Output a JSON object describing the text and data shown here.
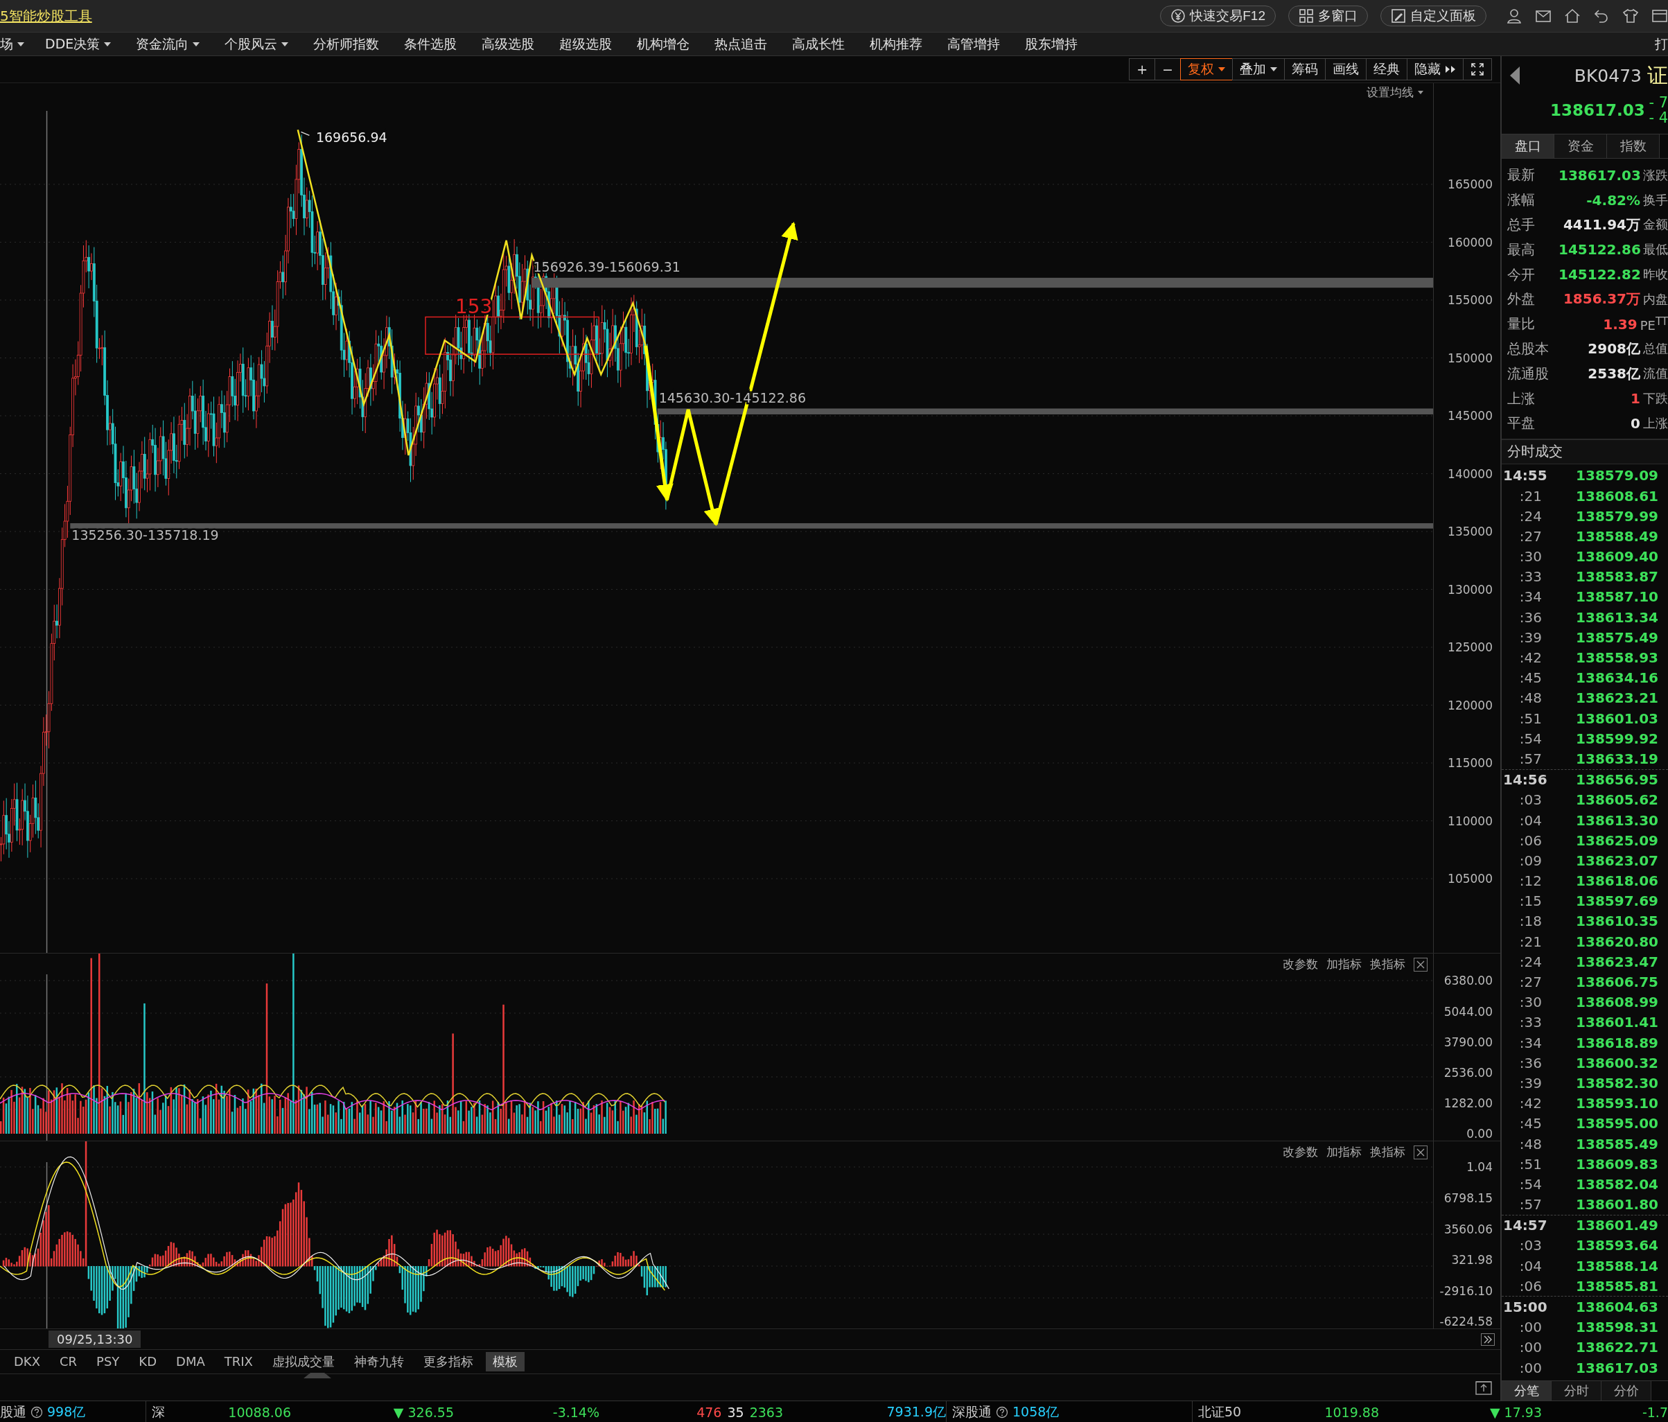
{
  "title_bar": {
    "app_title": "5智能炒股工具",
    "buttons": [
      {
        "label": "快速交易F12",
        "kind": "trade"
      },
      {
        "label": "多窗口",
        "kind": "grid"
      },
      {
        "label": "自定义面板",
        "kind": "edit"
      }
    ]
  },
  "menu": [
    {
      "label": "场",
      "dropdown": true
    },
    {
      "label": "DDE决策",
      "dropdown": true
    },
    {
      "label": "资金流向",
      "dropdown": true
    },
    {
      "label": "个股风云",
      "dropdown": true
    },
    {
      "label": "分析师指数",
      "dropdown": false
    },
    {
      "label": "条件选股",
      "dropdown": false
    },
    {
      "label": "高级选股",
      "dropdown": false
    },
    {
      "label": "超级选股",
      "dropdown": false
    },
    {
      "label": "机构增仓",
      "dropdown": false
    },
    {
      "label": "热点追击",
      "dropdown": false
    },
    {
      "label": "高成长性",
      "dropdown": false
    },
    {
      "label": "机构推荐",
      "dropdown": false
    },
    {
      "label": "高管增持",
      "dropdown": false
    },
    {
      "label": "股东增持",
      "dropdown": false
    }
  ],
  "menu_right": "打",
  "chart_toolbar": [
    {
      "kind": "text",
      "label": "+",
      "dropdown": false,
      "selected": false
    },
    {
      "kind": "text",
      "label": "−",
      "dropdown": false,
      "selected": false
    },
    {
      "kind": "text",
      "label": "复权",
      "dropdown": true,
      "selected": true
    },
    {
      "kind": "text",
      "label": "叠加",
      "dropdown": true,
      "selected": false
    },
    {
      "kind": "text",
      "label": "筹码",
      "dropdown": false,
      "selected": false
    },
    {
      "kind": "text",
      "label": "画线",
      "dropdown": false,
      "selected": false
    },
    {
      "kind": "text",
      "label": "经典",
      "dropdown": false,
      "selected": false
    },
    {
      "kind": "hide",
      "label": "隐藏",
      "dropdown": false,
      "selected": false
    },
    {
      "kind": "fullscreen",
      "dropdown": false,
      "selected": false
    }
  ],
  "ma_setting": "设置均线",
  "price_chart": {
    "y_axis": [
      "165000",
      "160000",
      "155000",
      "150000",
      "145000",
      "140000",
      "135000",
      "130000",
      "125000",
      "120000",
      "115000",
      "110000",
      "105000"
    ],
    "annotations": [
      {
        "kind": "peak",
        "text": "169656.94"
      },
      {
        "kind": "level",
        "text": "156926.39-156069.31"
      },
      {
        "kind": "marker",
        "text": "153"
      },
      {
        "kind": "level",
        "text": "145630.30-145122.86"
      },
      {
        "kind": "level",
        "text": "135256.30-135718.19"
      }
    ]
  },
  "volume_panel": {
    "actions": [
      "改参数",
      "加指标",
      "换指标"
    ],
    "y_axis": [
      "6380.00",
      "5044.00",
      "3790.00",
      "2536.00",
      "1282.00",
      "0.00"
    ]
  },
  "macd_panel": {
    "actions": [
      "改参数",
      "加指标",
      "换指标"
    ],
    "y_axis": [
      "1.04",
      "6798.15",
      "3560.06",
      "321.98",
      "-2916.10",
      "-6224.58"
    ]
  },
  "crosshair_date": "09/25,13:30",
  "indicator_tabs": [
    {
      "label": "DKX",
      "selected": false
    },
    {
      "label": "CR",
      "selected": false
    },
    {
      "label": "PSY",
      "selected": false
    },
    {
      "label": "KD",
      "selected": false
    },
    {
      "label": "DMA",
      "selected": false
    },
    {
      "label": "TRIX",
      "selected": false
    },
    {
      "label": "虚拟成交量",
      "selected": false
    },
    {
      "label": "神奇九转",
      "selected": false
    },
    {
      "label": "更多指标",
      "selected": false
    },
    {
      "label": "模板",
      "selected": true
    }
  ],
  "quote_header": {
    "code": "BK0473",
    "name": "证",
    "price": "138617.03",
    "change": "- 7",
    "change_pct": "- 4"
  },
  "quote_tabs": [
    {
      "label": "盘口",
      "selected": true
    },
    {
      "label": "资金",
      "selected": false
    },
    {
      "label": "指数",
      "selected": false
    }
  ],
  "quote_rows": [
    {
      "label": "最新",
      "value": "138617.03",
      "color": "#3de05a",
      "label2": "涨跌"
    },
    {
      "label": "涨幅",
      "value": "-4.82%",
      "color": "#3de05a",
      "label2": "换手"
    },
    {
      "label": "总手",
      "value": "4411.94万",
      "color": "#e6e6e6",
      "label2": "金额"
    },
    {
      "label": "最高",
      "value": "145122.86",
      "color": "#3de05a",
      "label2": "最低"
    },
    {
      "label": "今开",
      "value": "145122.82",
      "color": "#3de05a",
      "label2": "昨收"
    },
    {
      "label": "外盘",
      "value": "1856.37万",
      "color": "#ff4a4a",
      "label2": "内盘"
    },
    {
      "label": "量比",
      "value": "1.39",
      "color": "#ff4a4a",
      "label2": "PE$^{TT}$"
    },
    {
      "label": "总股本",
      "value": "2908亿",
      "color": "#e6e6e6",
      "label2": "总值"
    },
    {
      "label": "流通股",
      "value": "2538亿",
      "color": "#e6e6e6",
      "label2": "流值"
    },
    {
      "label": "上涨",
      "value": "1",
      "color": "#ff4a4a",
      "label2": "下跌"
    },
    {
      "label": "平盘",
      "value": "0",
      "color": "#e6e6e6",
      "label2": "上涨"
    }
  ],
  "ticks_title": "分时成交",
  "ticks": [
    {
      "kind": "minute",
      "time": "14:55",
      "price": "138579.09"
    },
    {
      "kind": "second",
      "time": ":21",
      "price": "138608.61"
    },
    {
      "kind": "second",
      "time": ":24",
      "price": "138579.99"
    },
    {
      "kind": "second",
      "time": ":27",
      "price": "138588.49"
    },
    {
      "kind": "second",
      "time": ":30",
      "price": "138609.40"
    },
    {
      "kind": "second",
      "time": ":33",
      "price": "138583.87"
    },
    {
      "kind": "second",
      "time": ":34",
      "price": "138587.10"
    },
    {
      "kind": "second",
      "time": ":36",
      "price": "138613.34"
    },
    {
      "kind": "second",
      "time": ":39",
      "price": "138575.49"
    },
    {
      "kind": "second",
      "time": ":42",
      "price": "138558.93"
    },
    {
      "kind": "second",
      "time": ":45",
      "price": "138634.16"
    },
    {
      "kind": "second",
      "time": ":48",
      "price": "138623.21"
    },
    {
      "kind": "second",
      "time": ":51",
      "price": "138601.03"
    },
    {
      "kind": "second",
      "time": ":54",
      "price": "138599.92"
    },
    {
      "kind": "second",
      "time": ":57",
      "price": "138633.19"
    },
    {
      "kind": "minute",
      "time": "14:56",
      "price": "138656.95"
    },
    {
      "kind": "second",
      "time": ":03",
      "price": "138605.62"
    },
    {
      "kind": "second",
      "time": ":04",
      "price": "138613.30"
    },
    {
      "kind": "second",
      "time": ":06",
      "price": "138625.09"
    },
    {
      "kind": "second",
      "time": ":09",
      "price": "138623.07"
    },
    {
      "kind": "second",
      "time": ":12",
      "price": "138618.06"
    },
    {
      "kind": "second",
      "time": ":15",
      "price": "138597.69"
    },
    {
      "kind": "second",
      "time": ":18",
      "price": "138610.35"
    },
    {
      "kind": "second",
      "time": ":21",
      "price": "138620.80"
    },
    {
      "kind": "second",
      "time": ":24",
      "price": "138623.47"
    },
    {
      "kind": "second",
      "time": ":27",
      "price": "138606.75"
    },
    {
      "kind": "second",
      "time": ":30",
      "price": "138608.99"
    },
    {
      "kind": "second",
      "time": ":33",
      "price": "138601.41"
    },
    {
      "kind": "second",
      "time": ":34",
      "price": "138618.89"
    },
    {
      "kind": "second",
      "time": ":36",
      "price": "138600.32"
    },
    {
      "kind": "second",
      "time": ":39",
      "price": "138582.30"
    },
    {
      "kind": "second",
      "time": ":42",
      "price": "138593.10"
    },
    {
      "kind": "second",
      "time": ":45",
      "price": "138595.00"
    },
    {
      "kind": "second",
      "time": ":48",
      "price": "138585.49"
    },
    {
      "kind": "second",
      "time": ":51",
      "price": "138609.83"
    },
    {
      "kind": "second",
      "time": ":54",
      "price": "138582.04"
    },
    {
      "kind": "second",
      "time": ":57",
      "price": "138601.80"
    },
    {
      "kind": "minute",
      "time": "14:57",
      "price": "138601.49"
    },
    {
      "kind": "second",
      "time": ":03",
      "price": "138593.64"
    },
    {
      "kind": "second",
      "time": ":04",
      "price": "138588.14"
    },
    {
      "kind": "second",
      "time": ":06",
      "price": "138585.81"
    },
    {
      "kind": "minute",
      "time": "15:00",
      "price": "138604.63"
    },
    {
      "kind": "second",
      "time": ":00",
      "price": "138598.31"
    },
    {
      "kind": "second",
      "time": ":00",
      "price": "138622.71"
    },
    {
      "kind": "second",
      "time": ":00",
      "price": "138617.03"
    }
  ],
  "tick_tabs": [
    {
      "label": "分笔",
      "selected": true
    },
    {
      "label": "分时",
      "selected": false
    },
    {
      "label": "分价",
      "selected": false
    }
  ],
  "status_bar": [
    [
      {
        "kind": "text",
        "text": "股通",
        "color": "#cccccc"
      },
      {
        "kind": "help"
      },
      {
        "kind": "text",
        "text": "998亿",
        "color": "#28d0ff"
      }
    ],
    [
      {
        "kind": "text",
        "text": "深",
        "color": "#cccccc"
      }
    ],
    [
      {
        "kind": "text",
        "text": "10088.06",
        "color": "#3de05a"
      }
    ],
    [
      {
        "kind": "text",
        "text": "▼ 326.55",
        "color": "#3de05a"
      }
    ],
    [
      {
        "kind": "text",
        "text": "-3.14%",
        "color": "#3de05a"
      }
    ],
    [
      {
        "kind": "text",
        "text": "476",
        "color": "#ff4a4a"
      },
      {
        "kind": "text",
        "text": "35",
        "color": "#e6e6e6"
      },
      {
        "kind": "text",
        "text": "2363",
        "color": "#3de05a"
      }
    ],
    [
      {
        "kind": "text",
        "text": "7931.9亿",
        "color": "#28d0ff"
      }
    ],
    [
      {
        "kind": "text",
        "text": "深股通",
        "color": "#cccccc"
      },
      {
        "kind": "help"
      },
      {
        "kind": "text",
        "text": "1058亿",
        "color": "#28d0ff"
      }
    ],
    [
      {
        "kind": "text",
        "text": "北证50",
        "color": "#cccccc"
      }
    ],
    [
      {
        "kind": "text",
        "text": "1019.88",
        "color": "#3de05a"
      }
    ],
    [
      {
        "kind": "text",
        "text": "▼ 17.93",
        "color": "#3de05a"
      }
    ],
    [
      {
        "kind": "text",
        "text": "-1.7",
        "color": "#3de05a"
      }
    ]
  ]
}
